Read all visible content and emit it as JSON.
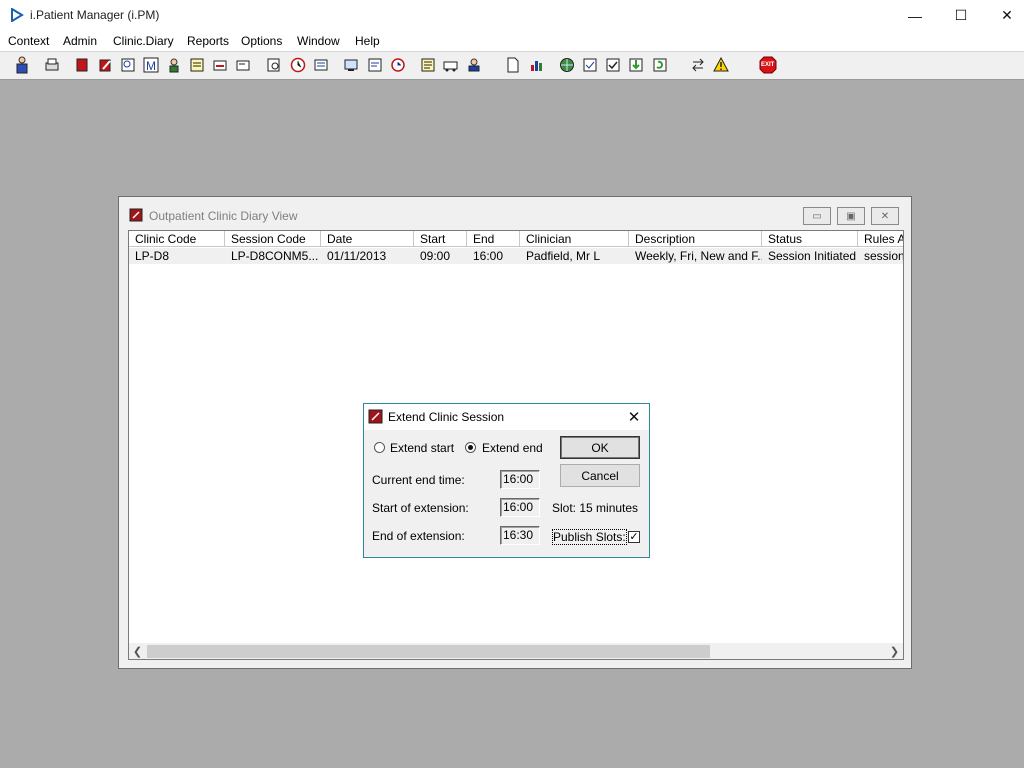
{
  "app": {
    "title": "i.Patient Manager (i.PM)"
  },
  "window_controls": {
    "minimize": "—",
    "maximize": "☐",
    "close": "✕"
  },
  "menu": [
    {
      "label": "Context"
    },
    {
      "label": "Admin"
    },
    {
      "label": "Clinic.Diary"
    },
    {
      "label": "Reports"
    },
    {
      "label": "Options"
    },
    {
      "label": "Window"
    },
    {
      "label": "Help"
    }
  ],
  "toolbar": {
    "exit_label": "EXIT"
  },
  "diary_window": {
    "title": "Outpatient Clinic Diary View",
    "columns": [
      "Clinic Code",
      "Session Code",
      "Date",
      "Start",
      "End",
      "Clinician",
      "Description",
      "Status",
      "Rules Ap"
    ],
    "rows": [
      [
        "LP-D8",
        "LP-D8CONM5...",
        "01/11/2013",
        "09:00",
        "16:00",
        "Padfield, Mr L",
        "Weekly, Fri, New and F...",
        "Session Initiated",
        "session"
      ]
    ]
  },
  "dialog": {
    "title": "Extend Clinic Session",
    "extend_start_label": "Extend start",
    "extend_end_label": "Extend end",
    "selected_option": "Extend end",
    "ok_label": "OK",
    "cancel_label": "Cancel",
    "current_end_time_label": "Current end time:",
    "current_end_time_value": "16:00",
    "start_of_extension_label": "Start of extension:",
    "start_of_extension_value": "16:00",
    "slot_label": "Slot: 15 minutes",
    "end_of_extension_label": "End of extension:",
    "end_of_extension_value": "16:30",
    "publish_slots_label": "Publish Slots:",
    "publish_slots_checked": true
  }
}
